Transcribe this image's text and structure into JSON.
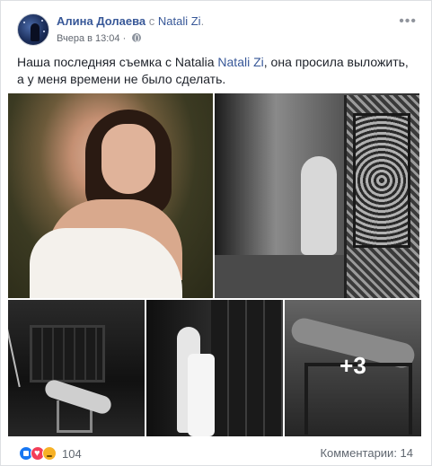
{
  "post": {
    "author": "Алина Долаева",
    "with_word": "с",
    "tagged_person": "Natali Zi",
    "tagged_suffix": ".",
    "timestamp": "Вчера в 13:04",
    "separator": "·",
    "privacy_icon": "globe-icon",
    "more_icon": "more-options-icon",
    "more_glyph": "•••",
    "text_before": "Наша последняя съемка с Natalia ",
    "text_tag": "Natali Zi",
    "text_after": ", она просила выложить, а у меня времени не было сделать."
  },
  "photos": {
    "extra_count": "+3"
  },
  "footer": {
    "reaction_icons": [
      "like-icon",
      "love-icon",
      "sad-icon"
    ],
    "reaction_count": "104",
    "comments": "Комментарии: 14"
  },
  "colors": {
    "link": "#385898",
    "like": "#1877f2",
    "love": "#f33e58",
    "sad": "#f7b125"
  }
}
